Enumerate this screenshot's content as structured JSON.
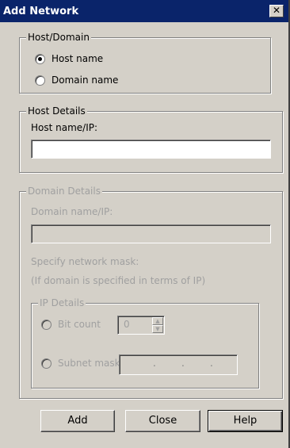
{
  "window": {
    "title": "Add Network",
    "close_glyph": "✕"
  },
  "host_domain": {
    "legend": "Host/Domain",
    "options": [
      {
        "label": "Host name",
        "checked": true
      },
      {
        "label": "Domain name",
        "checked": false
      }
    ]
  },
  "host_details": {
    "legend": "Host Details",
    "field_label": "Host name/IP:",
    "value": ""
  },
  "domain_details": {
    "legend": "Domain Details",
    "field_label": "Domain name/IP:",
    "value": "",
    "mask_label": "Specify network mask:",
    "mask_note": "(If domain is specified in terms of IP)",
    "ip_details": {
      "legend": "IP Details",
      "bit_count_label": "Bit count",
      "bit_count_value": "0",
      "subnet_mask_label": "Subnet mask",
      "subnet_dots": ".",
      "up_glyph": "▲",
      "down_glyph": "▼"
    }
  },
  "buttons": {
    "add": "Add",
    "close": "Close",
    "help": "Help"
  }
}
